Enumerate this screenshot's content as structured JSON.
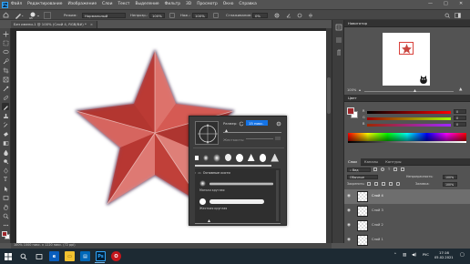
{
  "menubar": {
    "logo": "Ps",
    "items": [
      "Файл",
      "Редактирование",
      "Изображение",
      "Слои",
      "Текст",
      "Выделение",
      "Фильтр",
      "3D",
      "Просмотр",
      "Окно",
      "Справка"
    ],
    "win_min": "—",
    "win_max": "□",
    "win_close": "✕"
  },
  "options": {
    "brush_size": "95",
    "mode_label": "Режим:",
    "mode_value": "Нормальный",
    "opacity_label": "Непрозр.:",
    "opacity_value": "100%",
    "flow_label": "Наж.:",
    "flow_value": "100%",
    "smoothing_label": "Сглаживание:",
    "smoothing_value": "0%"
  },
  "document": {
    "tab_title": "Без имени-1 @ 100% (Слой 4, RGB/8#) *",
    "status_text": "100%   1000 пикс. x 1220 пикс. (72 ppi)"
  },
  "brush_popup": {
    "size_label": "Размер:",
    "size_value": "15 пикс.",
    "hardness_label": "Жесткость:",
    "preset_folder": "Основные кисти",
    "preset_soft": "Мягкая круглая",
    "preset_hard": "Жесткая круглая"
  },
  "navigator": {
    "title": "Навигатор",
    "zoom": "100%"
  },
  "color_panel": {
    "title": "Цвет",
    "r": "0",
    "g": "0",
    "b": "0"
  },
  "layers_panel": {
    "tabs": [
      "Слои",
      "Каналы",
      "Контуры"
    ],
    "filter_placeholder": "Вид",
    "blend_mode": "Обычные",
    "opacity_label": "Непрозрачность:",
    "opacity_value": "100%",
    "lock_label": "Закрепить:",
    "fill_label": "Заливка:",
    "fill_value": "100%",
    "layers": [
      {
        "name": "Слой 4",
        "selected": true
      },
      {
        "name": "Слой 3",
        "selected": false
      },
      {
        "name": "Слой 2",
        "selected": false
      },
      {
        "name": "Слой 1",
        "selected": false
      }
    ]
  },
  "taskbar": {
    "time": "17:16",
    "date": "05.02.2021",
    "lang": "РУС"
  },
  "colors": {
    "accent": "#1473e6",
    "star_base": "#c9463f",
    "foreground": "#a0262a",
    "background": "#ffffff"
  }
}
